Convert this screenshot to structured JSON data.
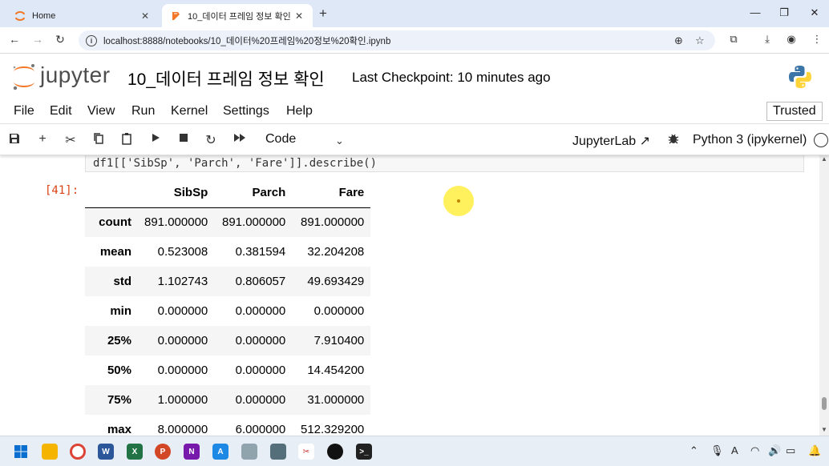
{
  "browser": {
    "tabs": [
      {
        "label": "Home",
        "active": false
      },
      {
        "label": "10_데이터 프레임 정보 확인",
        "active": true
      }
    ],
    "url": "localhost:8888/notebooks/10_데이터%20프레임%20정보%20확인.ipynb"
  },
  "jupyter": {
    "logo_text": "jupyter",
    "notebook_title": "10_데이터 프레임 정보 확인",
    "checkpoint": "Last Checkpoint: 10 minutes ago",
    "menu": [
      "File",
      "Edit",
      "View",
      "Run",
      "Kernel",
      "Settings",
      "Help"
    ],
    "trusted": "Trusted",
    "cell_type": "Code",
    "jupyterlab_label": "JupyterLab",
    "kernel_name": "Python 3 (ipykernel)"
  },
  "cell": {
    "code": "df1[['SibSp', 'Parch', 'Fare']].describe()",
    "out_prompt": "[41]:",
    "columns": [
      "SibSp",
      "Parch",
      "Fare"
    ],
    "rows": [
      {
        "index": "count",
        "values": [
          "891.000000",
          "891.000000",
          "891.000000"
        ]
      },
      {
        "index": "mean",
        "values": [
          "0.523008",
          "0.381594",
          "32.204208"
        ]
      },
      {
        "index": "std",
        "values": [
          "1.102743",
          "0.806057",
          "49.693429"
        ]
      },
      {
        "index": "min",
        "values": [
          "0.000000",
          "0.000000",
          "0.000000"
        ]
      },
      {
        "index": "25%",
        "values": [
          "0.000000",
          "0.000000",
          "7.910400"
        ]
      },
      {
        "index": "50%",
        "values": [
          "0.000000",
          "0.000000",
          "14.454200"
        ]
      },
      {
        "index": "75%",
        "values": [
          "1.000000",
          "0.000000",
          "31.000000"
        ]
      },
      {
        "index": "max",
        "values": [
          "8.000000",
          "6.000000",
          "512.329200"
        ]
      }
    ]
  },
  "colors": {
    "tabbar": "#dfe8f7",
    "out_prompt": "#d84315",
    "jupyter_orange": "#f37726",
    "cursor_highlight": "#ffeb28"
  }
}
